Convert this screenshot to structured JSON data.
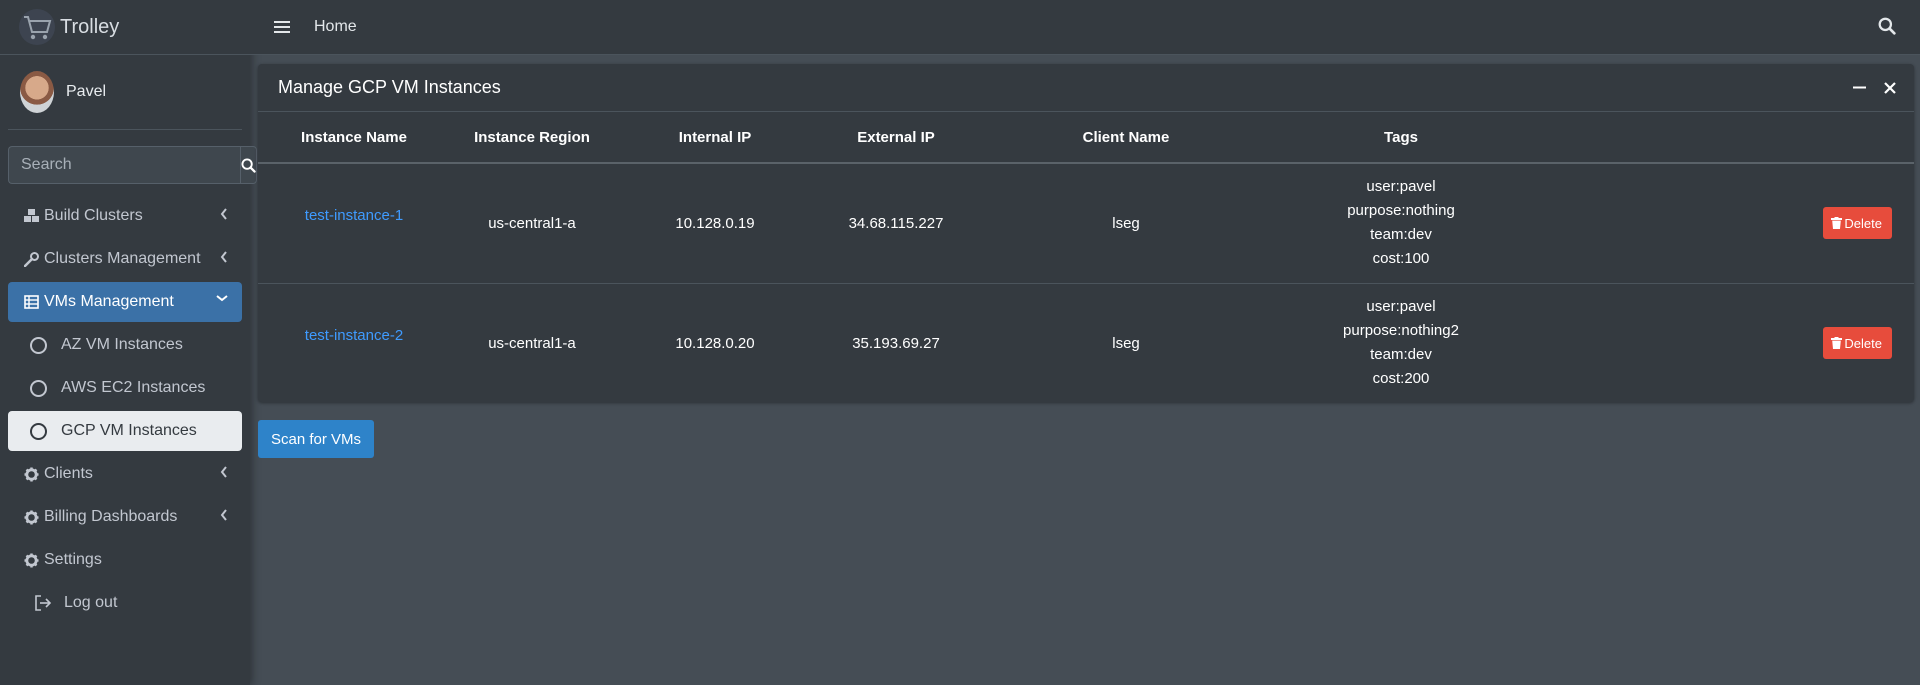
{
  "brand": {
    "name": "Trolley"
  },
  "user": {
    "name": "Pavel"
  },
  "sidebar_search": {
    "placeholder": "Search"
  },
  "nav": [
    {
      "label": "Build Clusters",
      "icon": "cubes-icon"
    },
    {
      "label": "Clusters Management",
      "icon": "wrench-icon"
    },
    {
      "label": "VMs Management",
      "icon": "server-icon"
    },
    {
      "label": "AZ VM Instances"
    },
    {
      "label": "AWS EC2 Instances"
    },
    {
      "label": "GCP VM Instances"
    },
    {
      "label": "Clients",
      "icon": "gear-icon"
    },
    {
      "label": "Billing Dashboards",
      "icon": "gear-icon"
    },
    {
      "label": "Settings",
      "icon": "gear-icon"
    },
    {
      "label": "Log out",
      "icon": "logout-icon"
    }
  ],
  "topbar": {
    "home": "Home"
  },
  "card": {
    "title": "Manage GCP VM Instances",
    "columns": [
      "Instance Name",
      "Instance Region",
      "Internal IP",
      "External IP",
      "Client Name",
      "Tags"
    ],
    "rows": [
      {
        "name": "test-instance-1",
        "region": "us-central1-a",
        "internal_ip": "10.128.0.19",
        "external_ip": "34.68.115.227",
        "client": "lseg",
        "tags": [
          "user:pavel",
          "purpose:nothing",
          "team:dev",
          "cost:100"
        ],
        "delete_label": "Delete"
      },
      {
        "name": "test-instance-2",
        "region": "us-central1-a",
        "internal_ip": "10.128.0.20",
        "external_ip": "35.193.69.27",
        "client": "lseg",
        "tags": [
          "user:pavel",
          "purpose:nothing2",
          "team:dev",
          "cost:200"
        ],
        "delete_label": "Delete"
      }
    ]
  },
  "scan_button": "Scan for VMs",
  "colors": {
    "sidebar_bg": "#343a40",
    "content_bg": "#454d55",
    "active_nav": "#3b71a7",
    "link": "#3f9bff",
    "delete": "#e74c3c",
    "primary": "#2e83c9"
  }
}
